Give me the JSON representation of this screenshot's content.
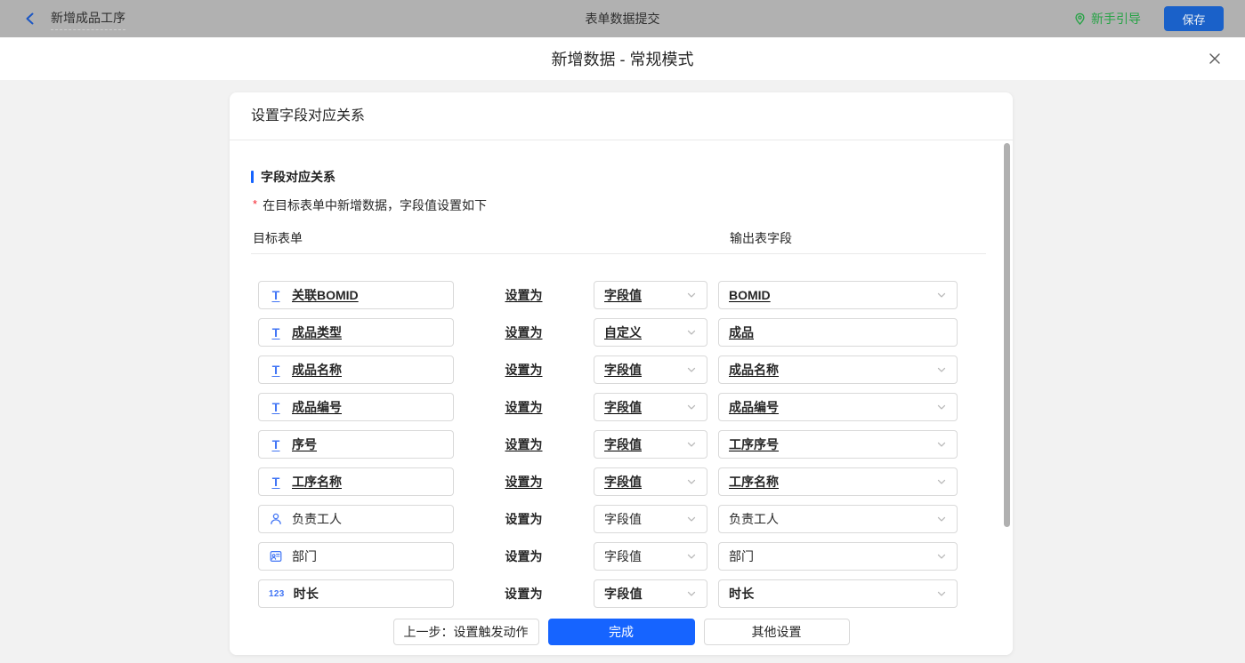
{
  "topbar": {
    "back_label": "新增成品工序",
    "center_title": "表单数据提交",
    "guide_label": "新手引导",
    "save_label": "保存"
  },
  "modal": {
    "title": "新增数据 - 常规模式",
    "close_icon": "close-x"
  },
  "card": {
    "header": "设置字段对应关系",
    "section_title": "字段对应关系",
    "required_mark": "*",
    "required_note": "在目标表单中新增数据，字段值设置如下",
    "col_left": "目标表单",
    "col_right": "输出表字段",
    "middle_label": "设置为"
  },
  "rows": [
    {
      "icon": "text",
      "field": "关联BOMID",
      "mode": "字段值",
      "value": "BOMID",
      "value_type": "select",
      "partial": false
    },
    {
      "icon": "text",
      "field": "成品类型",
      "mode": "自定义",
      "value": "成品",
      "value_type": "input",
      "partial": false
    },
    {
      "icon": "text",
      "field": "成品名称",
      "mode": "字段值",
      "value": "成品名称",
      "value_type": "select",
      "partial": false
    },
    {
      "icon": "text",
      "field": "成品编号",
      "mode": "字段值",
      "value": "成品编号",
      "value_type": "select",
      "partial": false
    },
    {
      "icon": "text",
      "field": "序号",
      "mode": "字段值",
      "value": "工序序号",
      "value_type": "select",
      "partial": false
    },
    {
      "icon": "text",
      "field": "工序名称",
      "mode": "字段值",
      "value": "工序名称",
      "value_type": "select",
      "partial": false
    },
    {
      "icon": "user",
      "field": "负责工人",
      "mode": "字段值",
      "value": "负责工人",
      "value_type": "select",
      "partial": false
    },
    {
      "icon": "dept",
      "field": "部门",
      "mode": "字段值",
      "value": "部门",
      "value_type": "select",
      "partial": false
    },
    {
      "icon": "number",
      "field": "时长",
      "mode": "字段值",
      "value": "时长",
      "value_type": "select",
      "partial": false
    },
    {
      "icon": "none",
      "field": "",
      "mode": "",
      "value": "",
      "value_type": "select",
      "partial": true
    }
  ],
  "footer": {
    "prev_label": "上一步：设置触发动作",
    "done_label": "完成",
    "other_label": "其他设置"
  },
  "colors": {
    "topbar_bg": "#b1b1b1",
    "accent_blue": "#1664ff",
    "save_button_blue": "#1a61c9",
    "guide_green": "#27a346",
    "field_icon_blue": "#4175f5",
    "required_red": "#f5222d",
    "border_gray": "#d9d9d9",
    "page_bg": "#f2f2f2"
  }
}
